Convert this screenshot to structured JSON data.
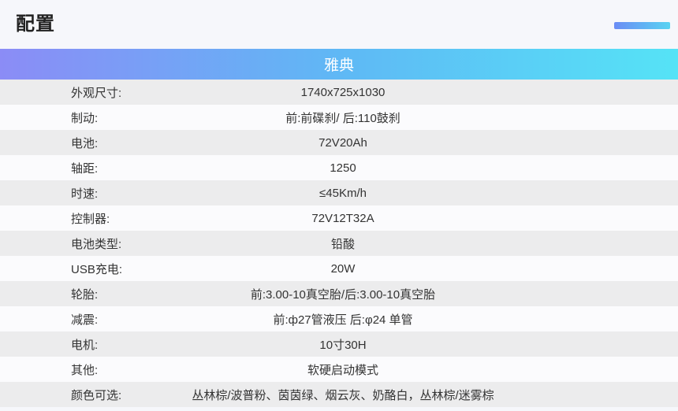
{
  "header": {
    "title": "配置"
  },
  "model": {
    "name": "雅典"
  },
  "specs": [
    {
      "label": "外观尺寸:",
      "value": "1740x725x1030"
    },
    {
      "label": "制动:",
      "value": "前:前碟刹/ 后:110鼓刹"
    },
    {
      "label": "电池:",
      "value": "72V20Ah"
    },
    {
      "label": "轴距:",
      "value": "1250"
    },
    {
      "label": "时速:",
      "value": "≤45Km/h"
    },
    {
      "label": "控制器:",
      "value": "72V12T32A"
    },
    {
      "label": "电池类型:",
      "value": "铅酸"
    },
    {
      "label": "USB充电:",
      "value": "20W"
    },
    {
      "label": "轮胎:",
      "value": "前:3.00-10真空胎/后:3.00-10真空胎"
    },
    {
      "label": "减震:",
      "value": "前:ф27管液压 后:φ24 单管"
    },
    {
      "label": "电机:",
      "value": "10寸30H"
    },
    {
      "label": "其他:",
      "value": "软硬启动模式"
    },
    {
      "label": "颜色可选:",
      "value": "丛林棕/波普粉、茵茵绿、烟云灰、奶酪白，丛林棕/迷雾棕"
    }
  ],
  "colors": {
    "gradient_start": "#8b8cf6",
    "gradient_end": "#55e3f6",
    "row_odd": "#ececed",
    "row_even": "#fbfbfd"
  }
}
